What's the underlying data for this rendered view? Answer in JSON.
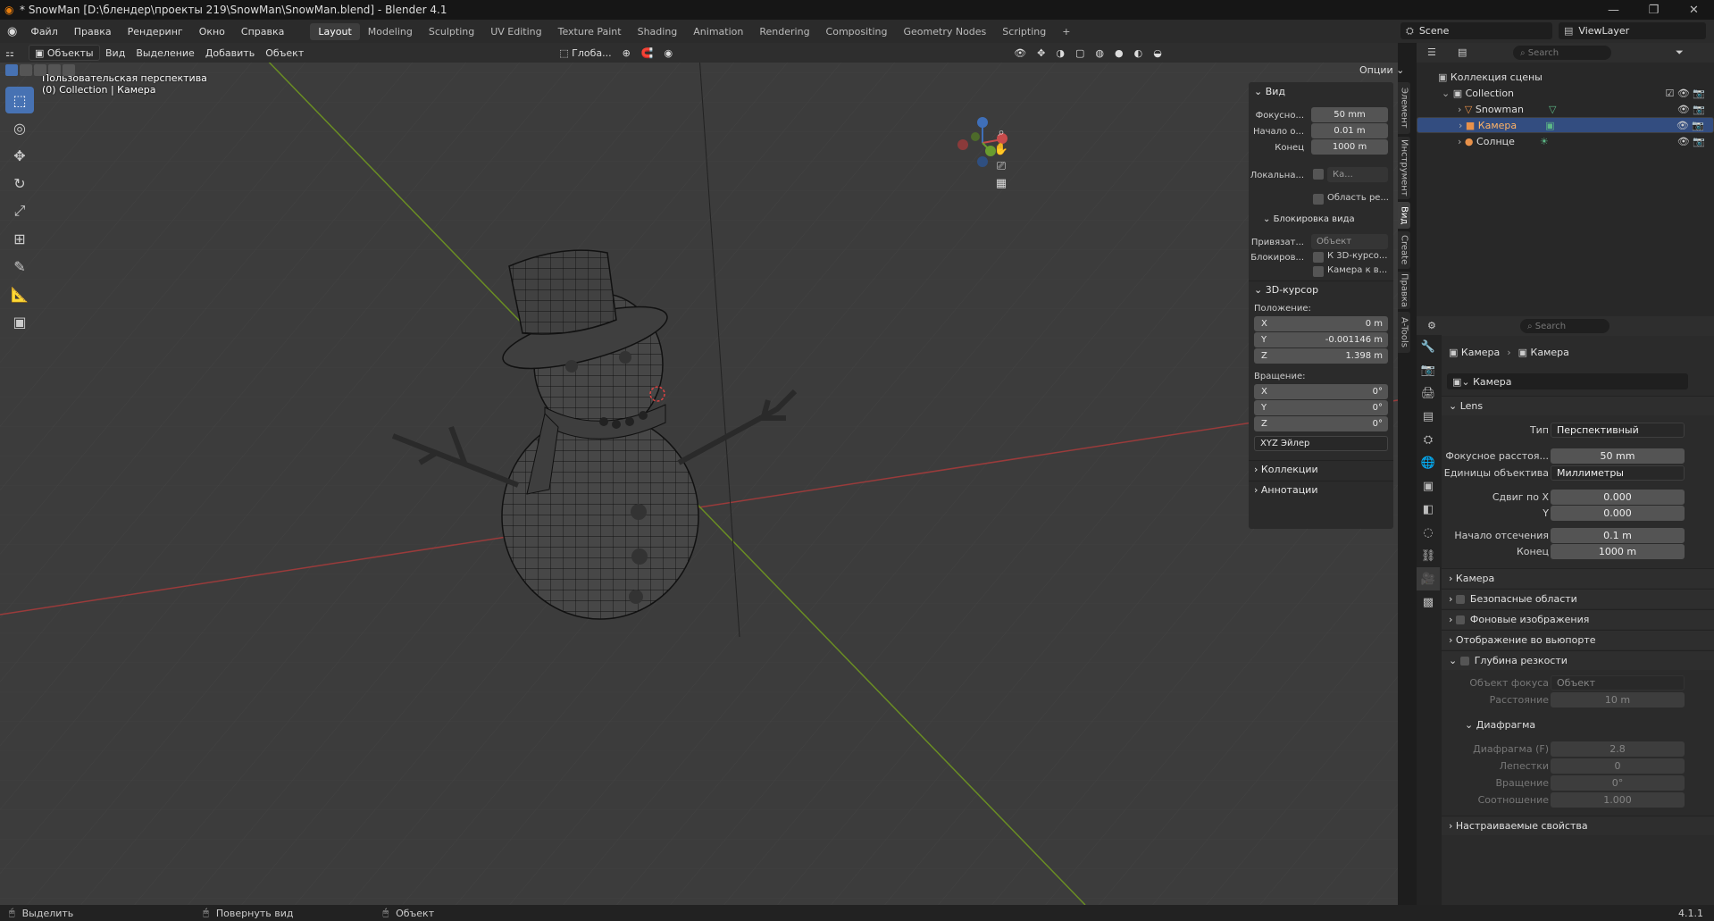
{
  "window": {
    "title": "* SnowMan [D:\\блендер\\проекты 219\\SnowMan\\SnowMan.blend] - Blender 4.1"
  },
  "menu": [
    "Файл",
    "Правка",
    "Рендеринг",
    "Окно",
    "Справка"
  ],
  "workspaces": [
    "Layout",
    "Modeling",
    "Sculpting",
    "UV Editing",
    "Texture Paint",
    "Shading",
    "Animation",
    "Rendering",
    "Compositing",
    "Geometry Nodes",
    "Scripting"
  ],
  "scene": {
    "name": "Scene",
    "viewlayer": "ViewLayer"
  },
  "viewport_header": {
    "mode": "Объекты",
    "menus": [
      "Вид",
      "Выделение",
      "Добавить",
      "Объект"
    ],
    "orientation": "Глоба...",
    "options": "Опции"
  },
  "viewport": {
    "line1": "Пользовательская перспектива",
    "line2": "(0) Collection | Камера"
  },
  "npanel": {
    "view_title": "Вид",
    "focal_label": "Фокусно...",
    "focal_value": "50 mm",
    "clip_start_label": "Начало о...",
    "clip_start_value": "0.01 m",
    "clip_end_label": "Конец",
    "clip_end_value": "1000 m",
    "local_label": "Локальна...",
    "local_value": "Ка...",
    "render_region": "Область ре...",
    "lock_title": "Блокировка вида",
    "lock_to_label": "Привязат...",
    "lock_to_value": "Объект",
    "lock_label": "Блокиров...",
    "lock_cursor": "К 3D-курсо...",
    "lock_camera": "Камера к в...",
    "cursor_title": "3D-курсор",
    "location_label": "Положение:",
    "loc_x": "0 m",
    "loc_y": "-0.001146 m",
    "loc_z": "1.398 m",
    "rotation_label": "Вращение:",
    "rot_x": "0°",
    "rot_y": "0°",
    "rot_z": "0°",
    "rot_mode": "XYZ Эйлер",
    "collections": "Коллекции",
    "annotations": "Аннотации",
    "x": "X",
    "y": "Y",
    "z": "Z"
  },
  "npanel_tabs": [
    "Элемент",
    "Инструмент",
    "Вид",
    "Create",
    "Правка",
    "A-Tools"
  ],
  "outliner": {
    "search": "Search",
    "scene_collection": "Коллекция сцены",
    "collection": "Collection",
    "items": [
      "Snowman",
      "Камера",
      "Солнце"
    ]
  },
  "properties": {
    "search": "Search",
    "breadcrumb_object": "Камера",
    "breadcrumb_data": "Камера",
    "datablock": "Камера",
    "lens_title": "Lens",
    "type_label": "Тип",
    "type_value": "Перспективный",
    "focal_label": "Фокусное расстоя...",
    "focal_value": "50 mm",
    "units_label": "Единицы объектива",
    "units_value": "Миллиметры",
    "shift_x_label": "Сдвиг по X",
    "shift_x_value": "0.000",
    "shift_y_label": "Y",
    "shift_y_value": "0.000",
    "clip_start_label": "Начало отсечения",
    "clip_start_value": "0.1 m",
    "clip_end_label": "Конец",
    "clip_end_value": "1000 m",
    "camera_section": "Камера",
    "safe_areas": "Безопасные области",
    "bg_images": "Фоновые изображения",
    "viewport_display": "Отображение во вьюпорте",
    "dof": "Глубина резкости",
    "focus_obj_label": "Объект фокуса",
    "focus_obj_value": "Объект",
    "distance_label": "Расстояние",
    "distance_value": "10 m",
    "aperture_title": "Диафрагма",
    "fstop_label": "Диафрагма (F)",
    "fstop_value": "2.8",
    "blades_label": "Лепестки",
    "blades_value": "0",
    "rotation_label": "Вращение",
    "rotation_value": "0°",
    "ratio_label": "Соотношение",
    "ratio_value": "1.000",
    "custom_props": "Настраиваемые свойства"
  },
  "status": {
    "select": "Выделить",
    "rotate": "Повернуть вид",
    "object": "Объект",
    "version": "4.1.1"
  }
}
